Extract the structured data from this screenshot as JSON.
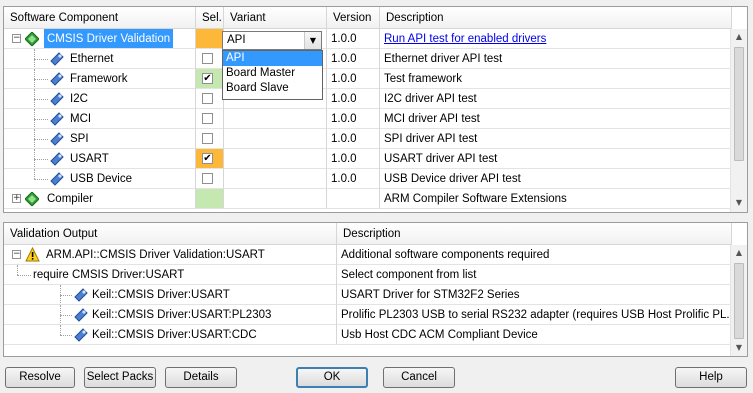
{
  "top_table": {
    "headers": {
      "component": "Software Component",
      "sel": "Sel.",
      "variant": "Variant",
      "version": "Version",
      "description": "Description"
    },
    "rows": [
      {
        "name": "CMSIS Driver Validation",
        "sel": "",
        "variant": "API",
        "version": "1.0.0",
        "description": "Run API test for enabled drivers",
        "level": 0,
        "expander": "−",
        "icon": "green-diamond-icon"
      },
      {
        "name": "Ethernet",
        "sel": "",
        "variant": "",
        "version": "1.0.0",
        "description": "Ethernet driver API test",
        "level": 1,
        "icon": "component-icon"
      },
      {
        "name": "Framework",
        "sel": "✔",
        "variant": "",
        "version": "1.0.0",
        "description": "Test framework",
        "level": 1,
        "icon": "component-icon"
      },
      {
        "name": "I2C",
        "sel": "",
        "variant": "",
        "version": "1.0.0",
        "description": "I2C driver API test",
        "level": 1,
        "icon": "component-icon"
      },
      {
        "name": "MCI",
        "sel": "",
        "variant": "",
        "version": "1.0.0",
        "description": "MCI driver API test",
        "level": 1,
        "icon": "component-icon"
      },
      {
        "name": "SPI",
        "sel": "",
        "variant": "",
        "version": "1.0.0",
        "description": "SPI driver API test",
        "level": 1,
        "icon": "component-icon"
      },
      {
        "name": "USART",
        "sel": "✔",
        "variant": "",
        "version": "1.0.0",
        "description": "USART driver API test",
        "level": 1,
        "icon": "component-icon"
      },
      {
        "name": "USB Device",
        "sel": "",
        "variant": "",
        "version": "1.0.0",
        "description": "USB Device driver API test",
        "level": 1,
        "icon": "component-icon"
      },
      {
        "name": "Compiler",
        "sel": "",
        "variant": "",
        "version": "",
        "description": "ARM Compiler Software Extensions",
        "level": 0,
        "expander": "+",
        "icon": "green-diamond-icon"
      }
    ]
  },
  "variant_dropdown": {
    "value": "API",
    "options": [
      "API",
      "Board Master",
      "Board Slave"
    ]
  },
  "validation_table": {
    "headers": {
      "output": "Validation Output",
      "description": "Description"
    },
    "rows": [
      {
        "text": "ARM.API::CMSIS Driver Validation:USART",
        "description": "Additional software components required"
      },
      {
        "text": "require CMSIS Driver:USART",
        "description": "Select component from list"
      },
      {
        "text": "Keil::CMSIS Driver:USART",
        "description": "USART Driver for STM32F2 Series"
      },
      {
        "text": "Keil::CMSIS Driver:USART:PL2303",
        "description": "Prolific PL2303 USB to serial RS232 adapter (requires USB Host Prolific PL..."
      },
      {
        "text": "Keil::CMSIS Driver:USART:CDC",
        "description": "Usb Host CDC ACM Compliant Device"
      }
    ]
  },
  "buttons": {
    "resolve": "Resolve",
    "select_packs": "Select Packs",
    "details": "Details",
    "ok": "OK",
    "cancel": "Cancel",
    "help": "Help"
  },
  "colors": {
    "selected_row": "#3399ff",
    "sel_required": "#fdb83a",
    "sel_ok": "#c4e8b0",
    "link": "#0000ee"
  }
}
